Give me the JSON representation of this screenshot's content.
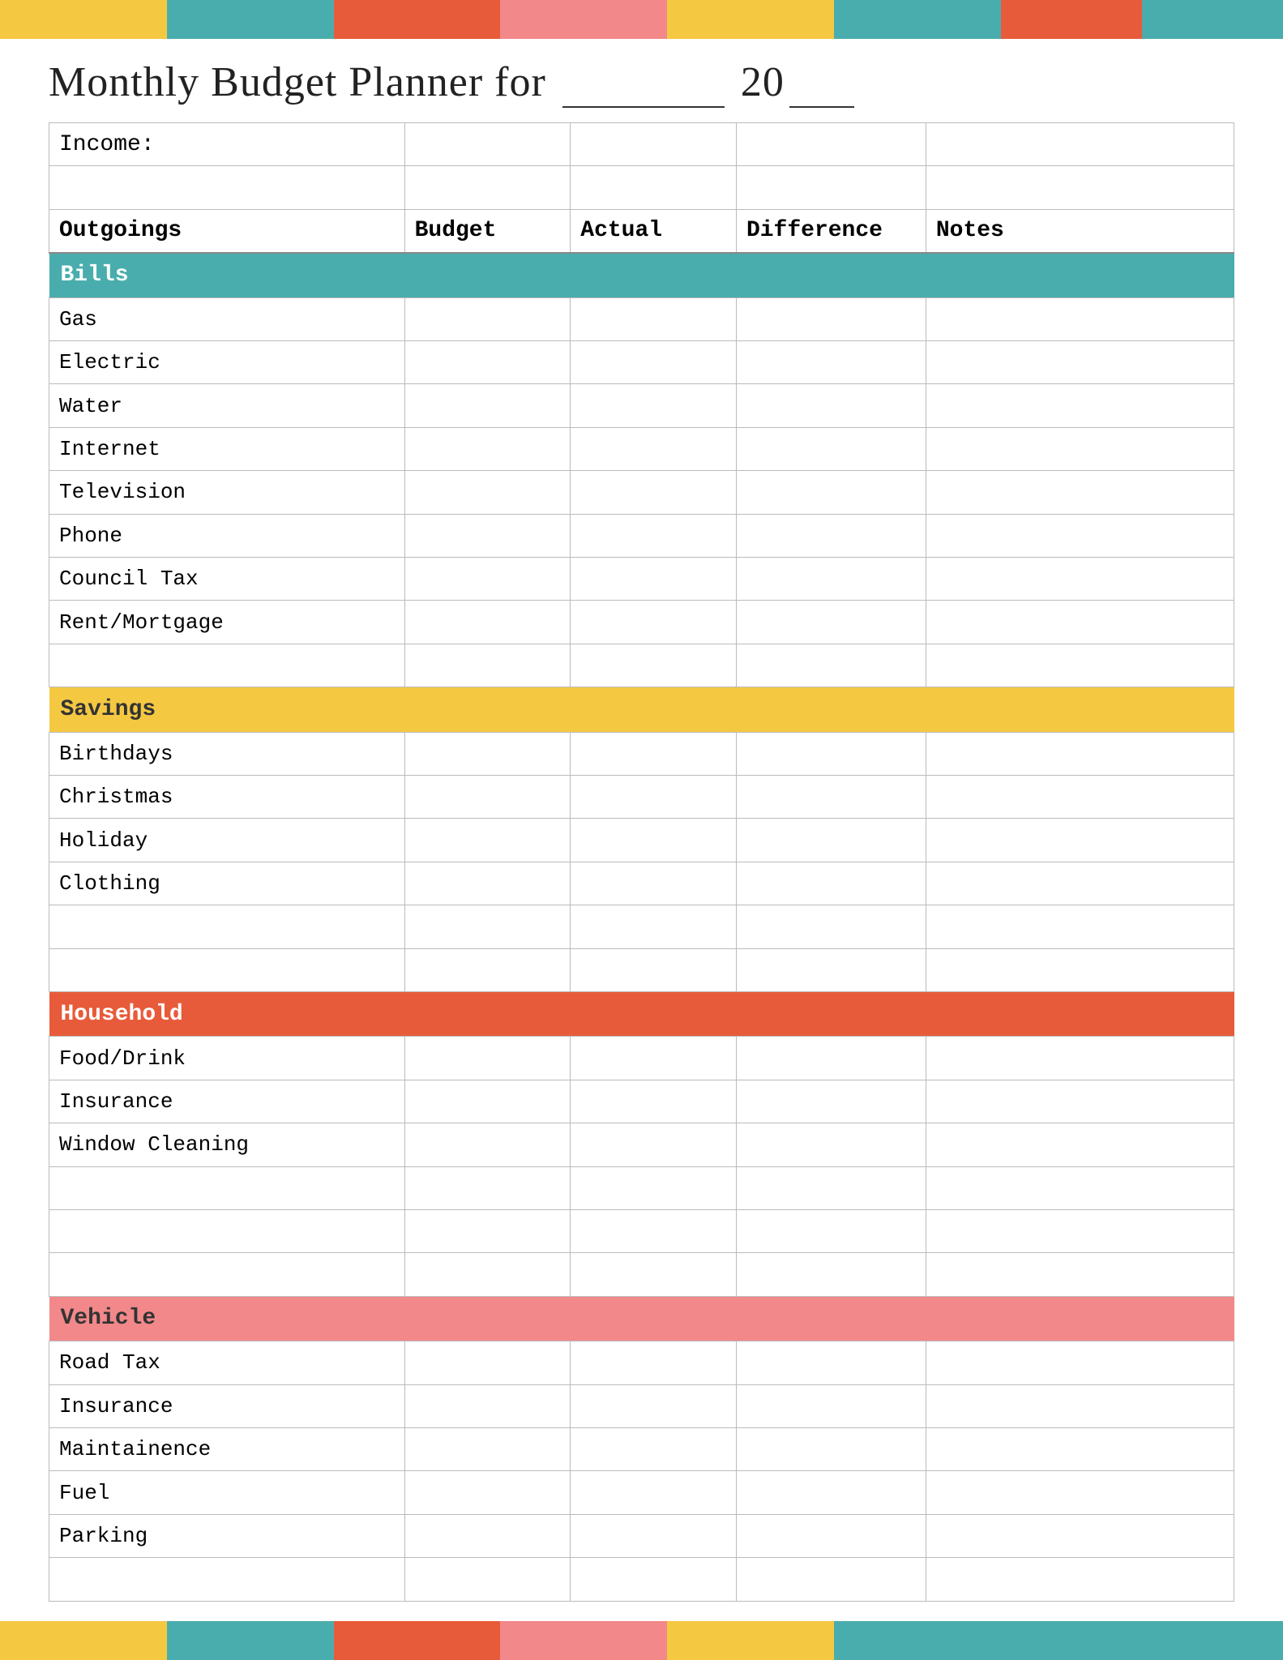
{
  "topBar": [
    {
      "color": "#F5C842",
      "width": "12%"
    },
    {
      "color": "#4AADAD",
      "width": "12%"
    },
    {
      "color": "#E85B3A",
      "width": "12%"
    },
    {
      "color": "#F2888A",
      "width": "12%"
    },
    {
      "color": "#F5C842",
      "width": "12%"
    },
    {
      "color": "#4AADAD",
      "width": "12%"
    },
    {
      "color": "#E85B3A",
      "width": "13%"
    },
    {
      "color": "#4AADAD",
      "width": "15%"
    }
  ],
  "bottomBar": [
    {
      "color": "#F5C842",
      "width": "12%"
    },
    {
      "color": "#4AADAD",
      "width": "12%"
    },
    {
      "color": "#E85B3A",
      "width": "12%"
    },
    {
      "color": "#F2888A",
      "width": "12%"
    },
    {
      "color": "#F5C842",
      "width": "12%"
    },
    {
      "color": "#4AADAD",
      "width": "15%"
    },
    {
      "color": "#4AADAD",
      "width": "13%"
    }
  ],
  "title": "Monthly Budget Planner for",
  "yearPrefix": "20",
  "columns": {
    "label": "Outgoings",
    "budget": "Budget",
    "actual": "Actual",
    "diff": "Difference",
    "notes": "Notes"
  },
  "incomeLabel": "Income:",
  "sections": {
    "bills": {
      "label": "Bills",
      "color": "#4AADAD",
      "textColor": "#fff",
      "items": [
        "Gas",
        "Electric",
        "Water",
        "Internet",
        "Television",
        "Phone",
        "Council Tax",
        "Rent/Mortgage"
      ]
    },
    "savings": {
      "label": "Savings",
      "color": "#F5C842",
      "textColor": "#333",
      "items": [
        "Birthdays",
        "Christmas",
        "Holiday",
        "Clothing"
      ]
    },
    "household": {
      "label": "Household",
      "color": "#E85B3A",
      "textColor": "#fff",
      "items": [
        "Food/Drink",
        "Insurance",
        "Window Cleaning"
      ]
    },
    "vehicle": {
      "label": "Vehicle",
      "color": "#F2888A",
      "textColor": "#333",
      "items": [
        "Road Tax",
        "Insurance",
        "Maintainence",
        "Fuel",
        "Parking"
      ]
    }
  }
}
